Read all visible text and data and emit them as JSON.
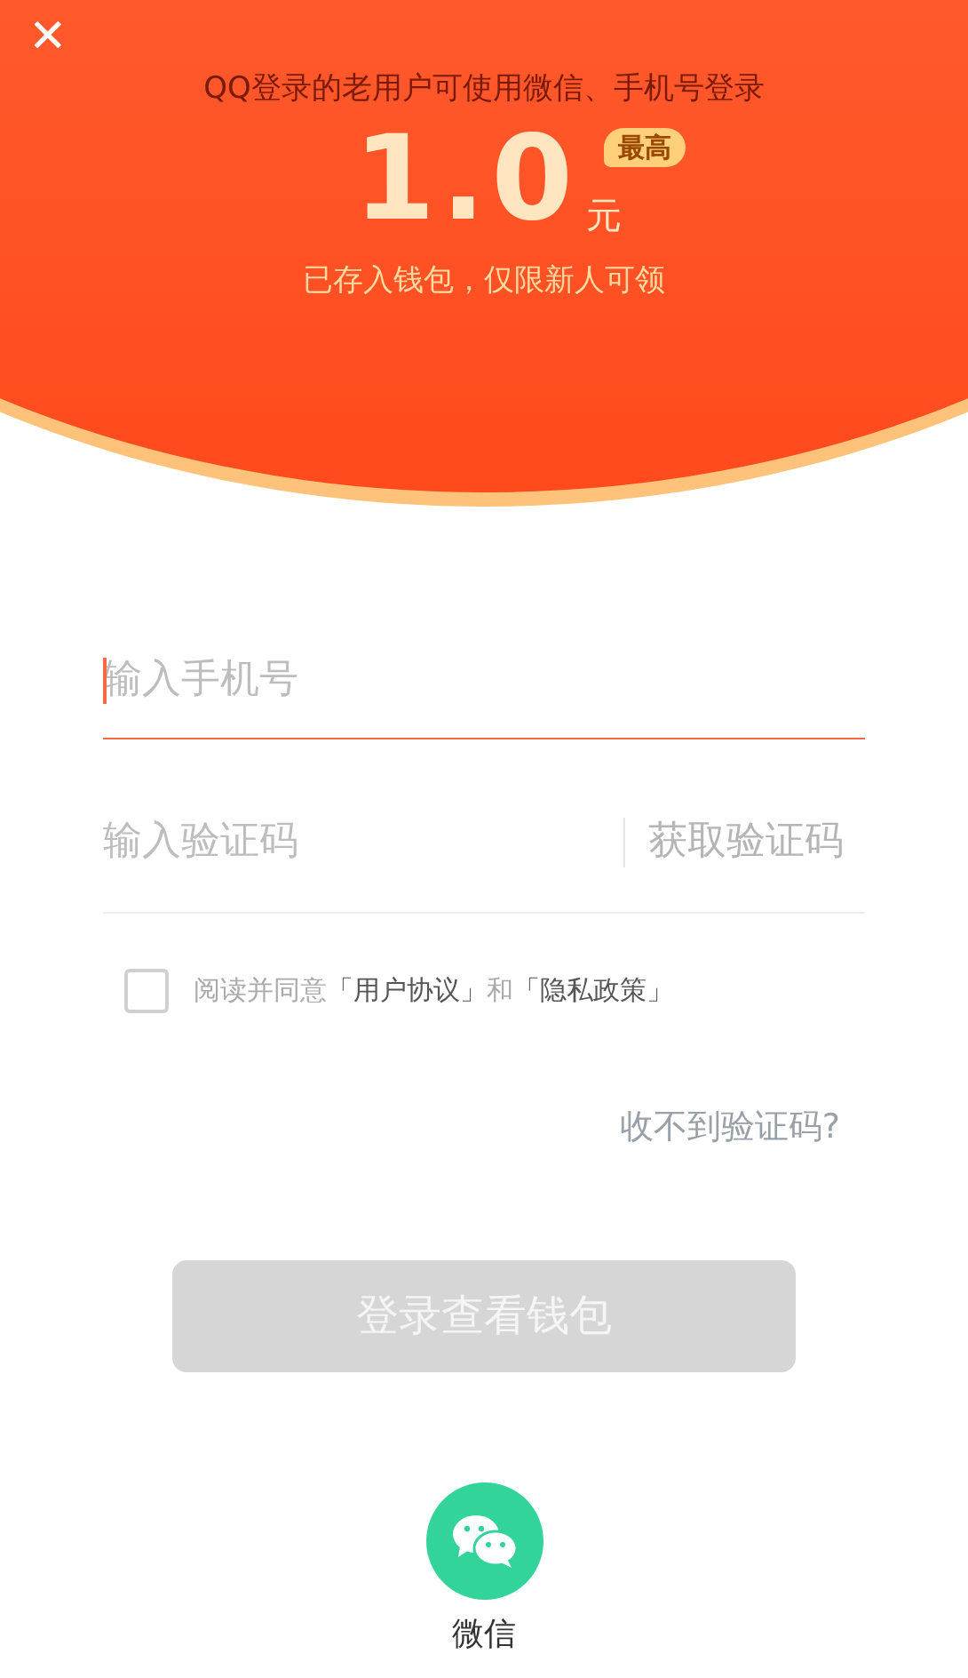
{
  "header": {
    "close": "✕",
    "notice": "QQ登录的老用户可使用微信、手机号登录",
    "amount": "1.0",
    "unit": "元",
    "badge": "最高",
    "subtitle": "已存入钱包，仅限新人可领"
  },
  "phone_field": {
    "placeholder": "输入手机号",
    "focused": true
  },
  "code_field": {
    "placeholder": "输入验证码",
    "action": "获取验证码"
  },
  "agreement": {
    "checked": false,
    "prefix": "阅读并同意",
    "terms": "「用户协议」",
    "and": "和",
    "privacy": "「隐私政策」"
  },
  "help_link": "收不到验证码?",
  "login_button": {
    "label": "登录查看钱包",
    "disabled": true
  },
  "social": [
    {
      "kind": "wechat",
      "label": "微信"
    }
  ]
}
